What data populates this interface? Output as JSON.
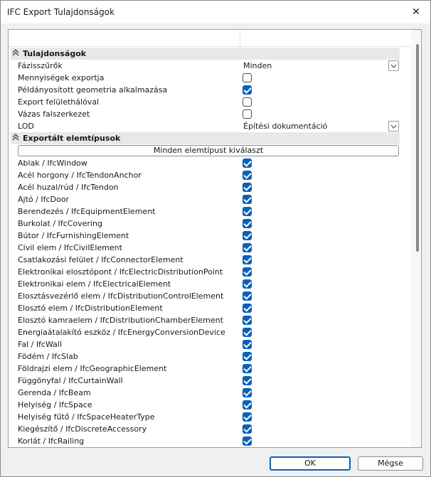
{
  "window": {
    "title": "IFC Export Tulajdonságok",
    "close_glyph": "✕"
  },
  "sections": {
    "properties": {
      "title": "Tulajdonságok",
      "chevron": "⌃"
    },
    "element_types": {
      "title": "Exportált elemtípusok",
      "chevron": "⌃"
    }
  },
  "properties": {
    "phase_filter": {
      "label": "Fázisszűrők",
      "value": "Minden"
    },
    "quantities_export": {
      "label": "Mennyiségek exportja",
      "checked": false
    },
    "instanced_geometry": {
      "label": "Példányosított geometria alkalmazása",
      "checked": true
    },
    "surface_mesh_export": {
      "label": "Export felülethálóval",
      "checked": false
    },
    "wireframe_walls": {
      "label": "Vázas falszerkezet",
      "checked": false
    },
    "lod": {
      "label": "LOD",
      "value": "Építési dokumentáció"
    }
  },
  "select_all_label": "Minden elemtípust kiválaszt",
  "element_types": [
    {
      "label": "Ablak / IfcWindow",
      "checked": true
    },
    {
      "label": "Acél horgony / IfcTendonAnchor",
      "checked": true
    },
    {
      "label": "Acél huzal/rúd / IfcTendon",
      "checked": true
    },
    {
      "label": "Ajtó / IfcDoor",
      "checked": true
    },
    {
      "label": "Berendezés / IfcEquipmentElement",
      "checked": true
    },
    {
      "label": "Burkolat / IfcCovering",
      "checked": true
    },
    {
      "label": "Bútor / IfcFurnishingElement",
      "checked": true
    },
    {
      "label": "Civil elem / IfcCivilElement",
      "checked": true
    },
    {
      "label": "Csatlakozási felület / IfcConnectorElement",
      "checked": true
    },
    {
      "label": "Elektronikai elosztópont / IfcElectricDistributionPoint",
      "checked": true
    },
    {
      "label": "Elektronikai elem / IfcElectricalElement",
      "checked": true
    },
    {
      "label": "Elosztásvezérlő elem / IfcDistributionControlElement",
      "checked": true
    },
    {
      "label": "Elosztó elem / IfcDistributionElement",
      "checked": true
    },
    {
      "label": "Elosztó kamraelem / IfcDistributionChamberElement",
      "checked": true
    },
    {
      "label": "Energiaátalakító eszköz / IfcEnergyConversionDevice",
      "checked": true
    },
    {
      "label": "Fal / IfcWall",
      "checked": true
    },
    {
      "label": "Födém / IfcSlab",
      "checked": true
    },
    {
      "label": "Földrajzi elem / IfcGeographicElement",
      "checked": true
    },
    {
      "label": "Függönyfal / IfcCurtainWall",
      "checked": true
    },
    {
      "label": "Gerenda / IfcBeam",
      "checked": true
    },
    {
      "label": "Helyiség / IfcSpace",
      "checked": true
    },
    {
      "label": "Helyiség fűtő / IfcSpaceHeaterType",
      "checked": true
    },
    {
      "label": "Kiegészítő / IfcDiscreteAccessory",
      "checked": true
    },
    {
      "label": "Korlát / IfcRailing",
      "checked": true
    }
  ],
  "footer": {
    "ok_label": "OK",
    "cancel_label": "Mégse"
  },
  "icons": {
    "dropdown": "chevron-down-icon",
    "section_toggle": "double-chevron-up-icon",
    "close": "close-icon"
  },
  "colors": {
    "accent": "#0a61b8",
    "section_bg": "#e8e8e8",
    "dialog_bg": "#f0f0f0"
  }
}
